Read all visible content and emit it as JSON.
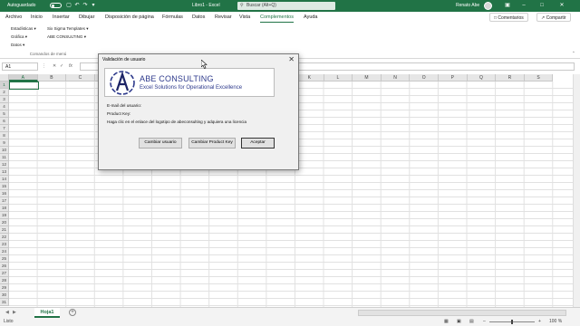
{
  "titlebar": {
    "autosave_label": "Autoguardado",
    "doc_title": "Libro1 - Excel",
    "search_placeholder": "Buscar (Alt+Q)",
    "user_name": "Renato Abe"
  },
  "menu": {
    "items": [
      "Archivo",
      "Inicio",
      "Insertar",
      "Dibujar",
      "Disposición de página",
      "Fórmulas",
      "Datos",
      "Revisar",
      "Vista",
      "Complementos",
      "Ayuda"
    ],
    "active": "Complementos",
    "comments_label": "Comentarios",
    "share_label": "Compartir"
  },
  "ribbon": {
    "col1": [
      "Estadísticas",
      "Gráfica",
      "Datos"
    ],
    "col2": [
      "Six Sigma Templates",
      "ABE CONSULTING"
    ],
    "group_label": "Comandos de menú"
  },
  "formula_bar": {
    "name_box": "A1",
    "fx": "fx"
  },
  "grid": {
    "columns": [
      "A",
      "B",
      "C",
      "D",
      "E",
      "F",
      "G",
      "H",
      "I",
      "J",
      "K",
      "L",
      "M",
      "N",
      "O",
      "P",
      "Q",
      "R",
      "S"
    ],
    "rows": [
      "1",
      "2",
      "3",
      "4",
      "5",
      "6",
      "7",
      "8",
      "9",
      "10",
      "11",
      "12",
      "13",
      "14",
      "15",
      "16",
      "17",
      "18",
      "19",
      "20",
      "21",
      "22",
      "23",
      "24",
      "25",
      "26",
      "27",
      "28",
      "29",
      "30",
      "31"
    ]
  },
  "sheet": {
    "tab_label": "Hoja1",
    "add_label": "+"
  },
  "status": {
    "mode": "Listo",
    "zoom": "100 %"
  },
  "dialog": {
    "title": "Validación de usuario",
    "logo_name": "ABE CONSULTING",
    "logo_tagline": "Excel Solutions for Operational Excellence",
    "email_label": "E-mail del usuario:",
    "key_label": "Product Key:",
    "hint": "Haga clic en el enlace del logotipo de abeconsulting y adquiera una licencia",
    "buttons": [
      "Cambiar usuario",
      "Cambiar Product Key",
      "Aceptar"
    ]
  },
  "colors": {
    "excel_green": "#217346",
    "logo_blue": "#2e3a8c"
  }
}
